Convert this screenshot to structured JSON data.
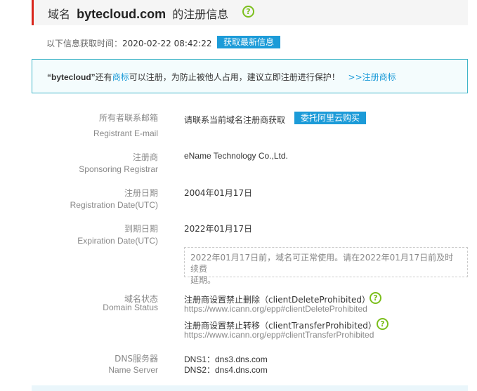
{
  "header": {
    "prefix": "域名",
    "domain": "bytecloud.com",
    "suffix": "的注册信息",
    "help_icon": "question-circle-icon"
  },
  "fetch": {
    "label": "以下信息获取时间：",
    "time": "2020-02-22 08:42:22",
    "button": "获取最新信息"
  },
  "notice": {
    "name": "“bytecloud”",
    "text1": "还有",
    "link_trademark": "商标",
    "text2": "可以注册，为防止被他人占用，建议立即注册进行保护！",
    "link_register": ">>注册商标"
  },
  "fields": {
    "email": {
      "label_cn": "所有者联系邮箱",
      "label_en": "Registrant E-mail",
      "value": "请联系当前域名注册商获取",
      "button": "委托阿里云购买"
    },
    "registrar": {
      "label_cn": "注册商",
      "label_en": "Sponsoring Registrar",
      "value": "eName Technology Co.,Ltd."
    },
    "reg_date": {
      "label_cn": "注册日期",
      "label_en": "Registration Date(UTC)",
      "value": "2004年01月17日"
    },
    "exp_date": {
      "label_cn": "到期日期",
      "label_en": "Expiration Date(UTC)",
      "value": "2022年01月17日",
      "note_line1": "2022年01月17日前，域名可正常使用。请在2022年01月17日前及时续费",
      "note_line2": "延期。"
    },
    "status": {
      "label_cn": "域名状态",
      "label_en": "Domain Status",
      "items": [
        {
          "text": "注册商设置禁止删除（clientDeleteProhibited）",
          "url": "https://www.icann.org/epp#clientDeleteProhibited"
        },
        {
          "text": "注册商设置禁止转移（clientTransferProhibited）",
          "url": "https://www.icann.org/epp#clientTransferProhibited"
        }
      ]
    },
    "dns": {
      "label_cn": "DNS服务器",
      "label_en": "Name Server",
      "values": [
        "DNS1：dns3.dns.com",
        "DNS2：dns4.dns.com"
      ]
    }
  },
  "colors": {
    "accent_red": "#d9261c",
    "button_blue": "#1c9bd8",
    "help_green": "#7cbf1d",
    "notice_border": "#40b5c8"
  }
}
